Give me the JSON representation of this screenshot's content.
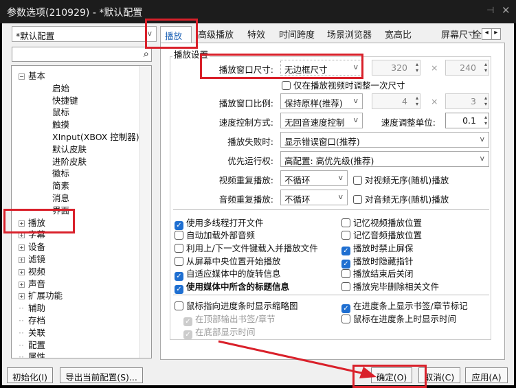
{
  "window": {
    "title": "参数选项(210929) - *默认配置",
    "pin": "⊣",
    "close": "✕"
  },
  "profile_combo": {
    "value": "*默认配置",
    "arrow": "v"
  },
  "search": {
    "value": "",
    "icon": "search-icon"
  },
  "tree": [
    {
      "label": "基本",
      "level": 0,
      "toggle": "−"
    },
    {
      "label": "启始",
      "level": 1
    },
    {
      "label": "快捷键",
      "level": 1
    },
    {
      "label": "鼠标",
      "level": 1
    },
    {
      "label": "触摸",
      "level": 1
    },
    {
      "label": "XInput(XBOX 控制器)",
      "level": 1
    },
    {
      "label": "默认皮肤",
      "level": 1
    },
    {
      "label": "进阶皮肤",
      "level": 1
    },
    {
      "label": "徽标",
      "level": 1
    },
    {
      "label": "简素",
      "level": 1
    },
    {
      "label": "消息",
      "level": 1
    },
    {
      "label": "界面",
      "level": 1
    },
    {
      "label": "播放",
      "level": 0,
      "toggle": "+"
    },
    {
      "label": "字幕",
      "level": 0,
      "toggle": "+"
    },
    {
      "label": "设备",
      "level": 0,
      "toggle": "+"
    },
    {
      "label": "滤镜",
      "level": 0,
      "toggle": "+"
    },
    {
      "label": "视频",
      "level": 0,
      "toggle": "+"
    },
    {
      "label": "声音",
      "level": 0,
      "toggle": "+"
    },
    {
      "label": "扩展功能",
      "level": 0,
      "toggle": "+"
    },
    {
      "label": "辅助",
      "level": 0
    },
    {
      "label": "存档",
      "level": 0
    },
    {
      "label": "关联",
      "level": 0
    },
    {
      "label": "配置",
      "level": 0
    },
    {
      "label": "属性",
      "level": 0
    }
  ],
  "tabs": [
    "播放",
    "高级播放",
    "特效",
    "时间跨度",
    "场景浏览器",
    "宽高比",
    "屏幕尺寸",
    "全"
  ],
  "tab_scroll": {
    "left": "◂",
    "right": "▸"
  },
  "group": {
    "title": "播放设置"
  },
  "form": {
    "window_size": {
      "label": "播放窗口尺寸:",
      "value": "无边框尺寸",
      "w": "320",
      "h": "240",
      "times": "×"
    },
    "resize_once": "仅在播放视频时调整一次尺寸",
    "ratio": {
      "label": "播放窗口比例:",
      "value": "保持原样(推荐)",
      "w": "4",
      "h": "3",
      "times": "×"
    },
    "speed": {
      "label": "速度控制方式:",
      "value": "无回音速度控制",
      "unit_label": "速度调整单位:",
      "unit": "0.1"
    },
    "fail": {
      "label": "播放失败时:",
      "value": "显示错误窗口(推荐)"
    },
    "priority": {
      "label": "优先运行权:",
      "value": "高配置: 高优先级(推荐)"
    },
    "video_repeat": {
      "label": "视频重复播放:",
      "value": "不循环",
      "shuffle": "对视频无序(随机)播放"
    },
    "audio_repeat": {
      "label": "音频重复播放:",
      "value": "不循环",
      "shuffle": "对音频无序(随机)播放"
    },
    "arrow": "v"
  },
  "checks_left": [
    {
      "label": "使用多线程打开文件",
      "checked": true
    },
    {
      "label": "自动加载外部音频",
      "checked": false
    },
    {
      "label": "利用上/下一文件键载入并播放文件",
      "checked": false
    },
    {
      "label": "从屏幕中央位置开始播放",
      "checked": false
    },
    {
      "label": "自适应媒体中的旋转信息",
      "checked": true
    },
    {
      "label": "使用媒体中所含的标题信息",
      "checked": true,
      "bold": true
    }
  ],
  "checks_right": [
    {
      "label": "记忆视频播放位置",
      "checked": false
    },
    {
      "label": "记忆音频播放位置",
      "checked": false
    },
    {
      "label": "播放时禁止屏保",
      "checked": true
    },
    {
      "label": "播放时隐藏指针",
      "checked": true
    },
    {
      "label": "播放结束后关闭",
      "checked": false
    },
    {
      "label": "播放完毕删除相关文件",
      "checked": false
    }
  ],
  "checks_bottom_left": [
    {
      "label": "鼠标指向进度条时显示缩略图",
      "checked": false
    },
    {
      "label": "在顶部输出书签/章节",
      "checked": true,
      "disabled": true
    },
    {
      "label": "在底部显示时间",
      "checked": true,
      "disabled": true
    }
  ],
  "checks_bottom_right": [
    {
      "label": "在进度条上显示书签/章节标记",
      "checked": true
    },
    {
      "label": "鼠标在进度条上时显示时间",
      "checked": false
    }
  ],
  "buttons": {
    "init": "初始化(I)",
    "export": "导出当前配置(S)...",
    "ok": "确定(O)",
    "cancel": "取消(C)",
    "apply": "应用(A)"
  },
  "colors": {
    "accent": "#1f6fd1",
    "annotation": "#d9202a"
  }
}
